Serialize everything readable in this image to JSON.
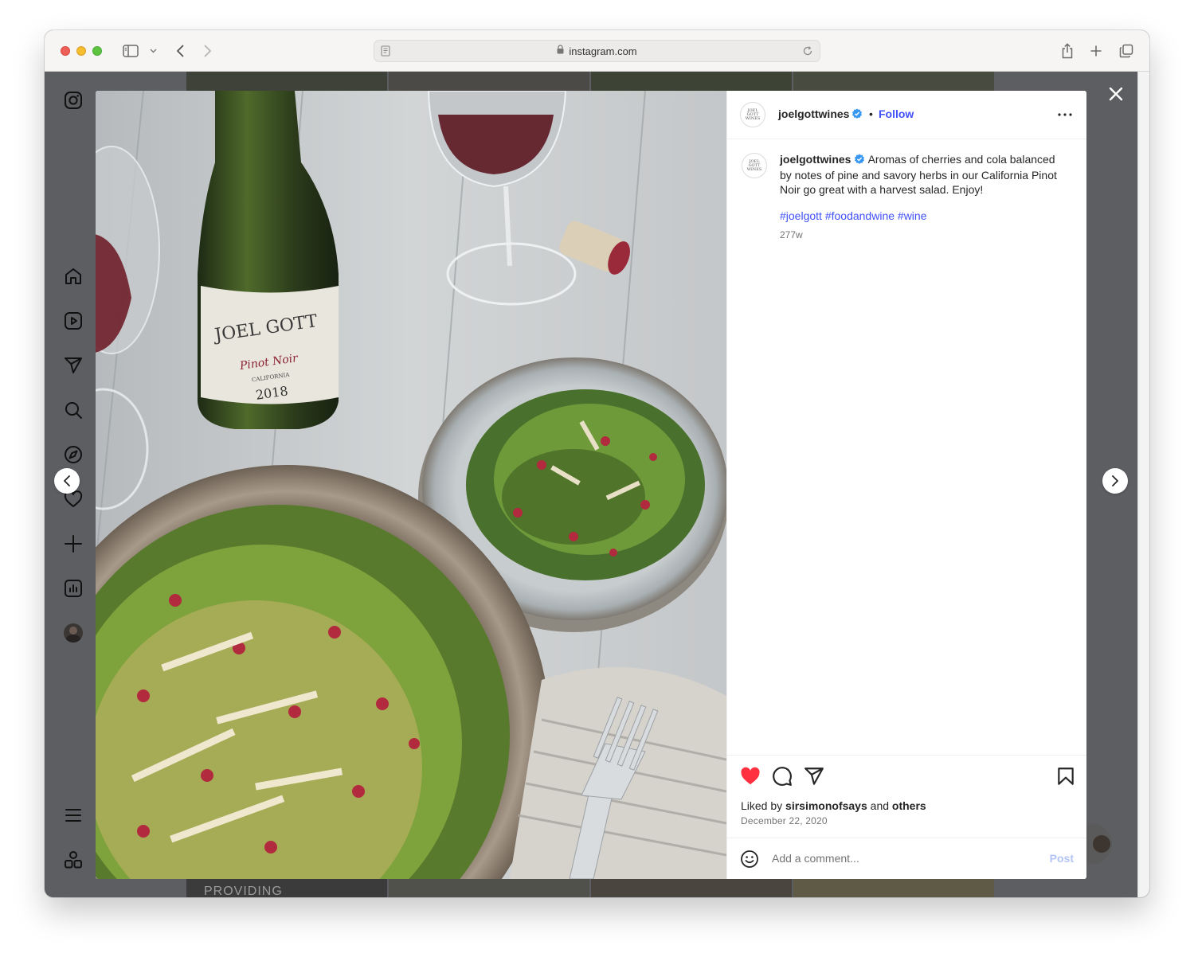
{
  "browser": {
    "url": "instagram.com"
  },
  "post": {
    "username": "joelgottwines",
    "avatar_text": "JOEL GOTT WINES",
    "follow_label": "Follow",
    "caption": "Aromas of cherries and cola balanced by notes of pine and savory herbs in our California Pinot Noir go great with a harvest salad. Enjoy!",
    "hashtags": [
      "#joelgott",
      "#foodandwine",
      "#wine"
    ],
    "age": "277w",
    "liked_prefix": "Liked by",
    "liked_user": "sirsimonofsays",
    "liked_and": "and",
    "liked_others": "others",
    "date": "December 22, 2020",
    "comment_placeholder": "Add a comment...",
    "post_label": "Post"
  },
  "photo": {
    "bottle_brand": "JOEL GOTT",
    "bottle_varietal": "Pinot Noir",
    "bottle_region": "CALIFORNIA",
    "bottle_year": "2018",
    "background_text": "PROVIDING"
  },
  "icons": {
    "sidebar": [
      "instagram-logo-icon",
      "home-icon",
      "reels-icon",
      "direct-icon",
      "search-icon",
      "explore-icon",
      "heart-icon",
      "create-icon",
      "insights-icon",
      "profile-avatar",
      "menu-icon",
      "more-icon"
    ],
    "actions": [
      "like-icon",
      "comment-icon",
      "share-icon",
      "save-icon"
    ]
  },
  "colors": {
    "accent": "#4150f7",
    "like": "#ff3040",
    "overlay": "#5c5e61"
  }
}
